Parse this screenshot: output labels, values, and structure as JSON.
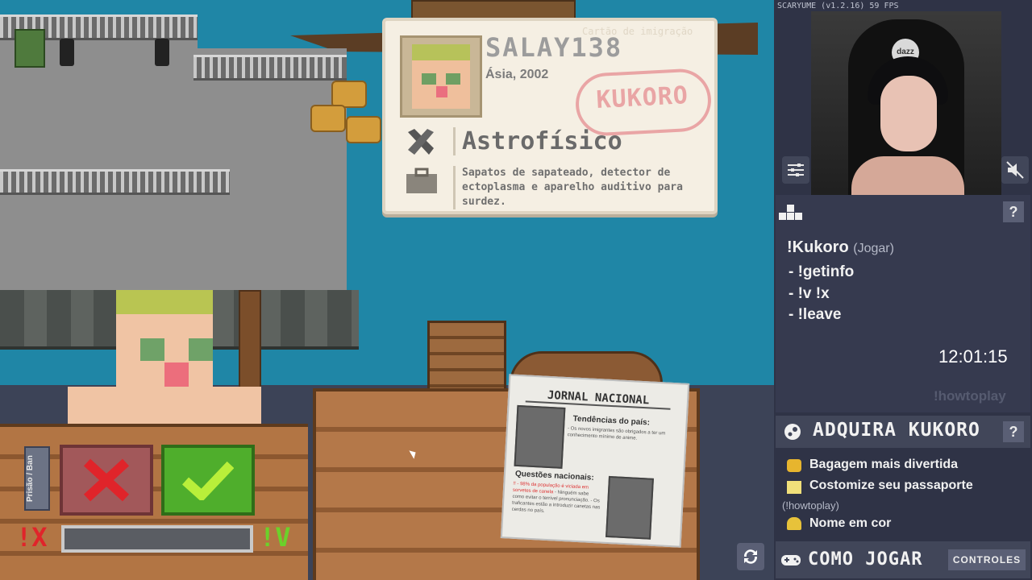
{
  "app": {
    "version": "SCARYUME (v1.2.16) 59 FPS"
  },
  "card": {
    "watermark": "Cartão de imigração",
    "name": "SALAY138",
    "origin": "Ásia, 2002",
    "stamp": "KUKORO",
    "profession": "Astrofísico",
    "items": "Sapatos de sapateado, detector de ectoplasma e aparelho auditivo para surdez."
  },
  "controls": {
    "ban_tag": "Prisão / Ban",
    "reject_cmd": "!X",
    "approve_cmd": "!V",
    "vote_progress": 0
  },
  "newspaper": {
    "title": "JORNAL NACIONAL",
    "headline1": "Tendências do país:",
    "text1": "- Os novos imigrantes são obrigados a ter um conhecimento mínimo de anime.",
    "headline2": "Questões nacionais:",
    "text2_red": "!! - 98% da população é viciada em sorvetes de canela",
    "text2": "- Ninguém sabe como evitar o terrível pronunciação. - Os traficantes estão a introduzir canetas nas cerdas no país."
  },
  "webcam": {
    "logo": "dazz"
  },
  "commands": {
    "main": "!Kukoro",
    "main_sub": "(Jogar)",
    "lines": [
      "- !getinfo",
      "- !v !x",
      "- !leave"
    ],
    "clock": "12:01:15",
    "howto": "!howtoplay"
  },
  "buy": {
    "title": "ADQUIRA KUKORO",
    "perks": [
      "Bagagem mais divertida",
      "Costomize seu passaporte",
      "Nome em cor"
    ],
    "howto": "(!howtoplay)"
  },
  "howplay": {
    "title": "COMO JOGAR",
    "controls_label": "CONTROLES"
  },
  "help_label": "?"
}
